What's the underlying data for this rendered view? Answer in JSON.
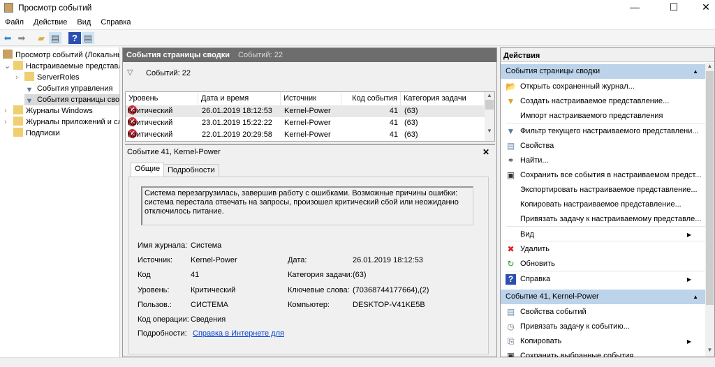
{
  "window": {
    "title": "Просмотр событий",
    "minimize": "—",
    "maximize": "☐",
    "close": "✕"
  },
  "menu": [
    "Файл",
    "Действие",
    "Вид",
    "Справка"
  ],
  "toolbar": {
    "back": "back-icon",
    "forward": "forward-icon",
    "up": "folder-up-icon",
    "show_tree": "console-tree-icon",
    "help": "help-icon",
    "show_actions": "action-pane-icon"
  },
  "tree": [
    {
      "label": "Просмотр событий (Локальный)",
      "icon": "event-viewer-icon"
    },
    {
      "label": "Настраиваемые представления",
      "icon": "folder-filter-icon",
      "expanded": true
    },
    {
      "label": "ServerRoles",
      "icon": "folder-icon"
    },
    {
      "label": "События управления",
      "icon": "filter-icon"
    },
    {
      "label": "События страницы сводки",
      "icon": "filter-icon",
      "selected": true
    },
    {
      "label": "Журналы Windows",
      "icon": "folder-log-icon"
    },
    {
      "label": "Журналы приложений и служб",
      "icon": "folder-log-icon"
    },
    {
      "label": "Подписки",
      "icon": "subscription-icon"
    }
  ],
  "center": {
    "header_title": "События страницы сводки",
    "header_count": "Событий: 22",
    "filter_count": "Событий: 22",
    "columns": [
      "Уровень",
      "Дата и время",
      "Источник",
      "Код события",
      "Категория задачи"
    ],
    "rows": [
      {
        "level": "Критический",
        "date": "26.01.2019 18:12:53",
        "source": "Kernel-Power",
        "code": "41",
        "category": "(63)"
      },
      {
        "level": "Критический",
        "date": "23.01.2019 15:22:22",
        "source": "Kernel-Power",
        "code": "41",
        "category": "(63)"
      },
      {
        "level": "Критический",
        "date": "22.01.2019 20:29:58",
        "source": "Kernel-Power",
        "code": "41",
        "category": "(63)"
      }
    ]
  },
  "detail": {
    "title": "Событие 41, Kernel-Power",
    "close": "✕",
    "tabs": [
      "Общие",
      "Подробности"
    ],
    "description": "Система перезагрузилась, завершив работу с ошибками. Возможные причины ошибки: система перестала отвечать на запросы, произошел критический сбой или неожиданно отключилось питание.",
    "fields_left": [
      {
        "label": "Имя журнала:",
        "value": "Система"
      },
      {
        "label": "Источник:",
        "value": "Kernel-Power"
      },
      {
        "label": "Код",
        "value": "41"
      },
      {
        "label": "Уровень:",
        "value": "Критический"
      },
      {
        "label": "Пользов.:",
        "value": "СИСТЕМА"
      },
      {
        "label": "Код операции:",
        "value": "Сведения"
      },
      {
        "label": "Подробности:",
        "value": "Справка в Интернете для"
      }
    ],
    "fields_right": [
      {
        "label": "Дата:",
        "value": "26.01.2019 18:12:53"
      },
      {
        "label": "Категория задачи:",
        "value": "(63)"
      },
      {
        "label": "Ключевые слова:",
        "value": "(70368744177664),(2)"
      },
      {
        "label": "Компьютер:",
        "value": "DESKTOP-V41KE5B"
      }
    ]
  },
  "actions": {
    "title": "Действия",
    "section1": "События страницы сводки",
    "items1": [
      {
        "label": "Открыть сохраненный журнал...",
        "icon": "open-log-icon"
      },
      {
        "label": "Создать настраиваемое представление...",
        "icon": "create-filter-icon"
      },
      {
        "label": "Импорт настраиваемого представления",
        "icon": ""
      },
      {
        "label": "Фильтр текущего настраиваемого представлени...",
        "icon": "filter-icon"
      },
      {
        "label": "Свойства",
        "icon": "properties-icon"
      },
      {
        "label": "Найти...",
        "icon": "binoculars-icon"
      },
      {
        "label": "Сохранить все события в настраиваемом предст...",
        "icon": "save-icon"
      },
      {
        "label": "Экспортировать настраиваемое представление...",
        "icon": ""
      },
      {
        "label": "Копировать настраиваемое представление...",
        "icon": ""
      },
      {
        "label": "Привязать задачу к настраиваемому представле...",
        "icon": ""
      },
      {
        "label": "Вид",
        "icon": "",
        "submenu": true
      },
      {
        "label": "Удалить",
        "icon": "delete-icon"
      },
      {
        "label": "Обновить",
        "icon": "refresh-icon"
      },
      {
        "label": "Справка",
        "icon": "help-icon",
        "submenu": true
      }
    ],
    "section2": "Событие 41, Kernel-Power",
    "items2": [
      {
        "label": "Свойства событий",
        "icon": "properties-icon"
      },
      {
        "label": "Привязать задачу к событию...",
        "icon": "task-icon"
      },
      {
        "label": "Копировать",
        "icon": "copy-icon",
        "submenu": true
      },
      {
        "label": "Сохранить выбранные события...",
        "icon": "save-icon"
      }
    ]
  },
  "colors": {
    "header_dark": "#6d6d6d",
    "section_blue": "#bcd3ea",
    "link": "#0645d6",
    "critical": "#c8303a"
  }
}
